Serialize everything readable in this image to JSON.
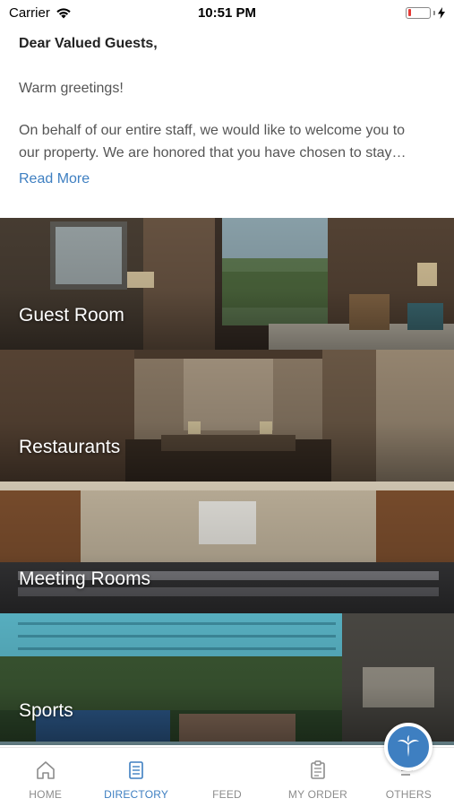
{
  "status_bar": {
    "carrier": "Carrier",
    "time": "10:51 PM",
    "battery_level": 0.15
  },
  "welcome": {
    "greeting": "Dear Valued Guests,",
    "line1": "Warm greetings!",
    "paragraph_line1": "On behalf of our entire staff, we would like to welcome you to",
    "paragraph_line2": "our property. We are honored that you have chosen to stay…",
    "read_more": "Read More"
  },
  "categories": [
    {
      "label": "Guest Room",
      "icon": "guest-room-photo"
    },
    {
      "label": "Restaurants",
      "icon": "restaurant-photo"
    },
    {
      "label": "Meeting Rooms",
      "icon": "meeting-room-photo"
    },
    {
      "label": "Sports",
      "icon": "pool-aerial-photo"
    }
  ],
  "tabbar": {
    "active": "DIRECTORY",
    "accent_color": "#3e7fc1",
    "inactive_color": "#8c8c8c",
    "tabs": [
      {
        "label": "HOME",
        "icon": "home-icon"
      },
      {
        "label": "DIRECTORY",
        "icon": "directory-icon"
      },
      {
        "label": "FEED",
        "icon": "feed-logo-icon"
      },
      {
        "label": "MY ORDER",
        "icon": "clipboard-icon"
      },
      {
        "label": "OTHERS",
        "icon": "menu-lines-icon"
      }
    ]
  }
}
